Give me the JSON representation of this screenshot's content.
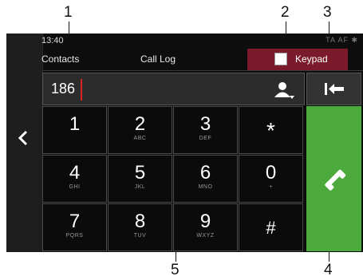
{
  "callouts": [
    "1",
    "2",
    "3",
    "4",
    "5"
  ],
  "status": {
    "time": "13:40",
    "indicators": "TA AF ✱"
  },
  "tabs": {
    "contacts": "Contacts",
    "call_log": "Call Log",
    "keypad": "Keypad"
  },
  "number_field": {
    "value": "186"
  },
  "keys": [
    {
      "digit": "1",
      "letters": ""
    },
    {
      "digit": "2",
      "letters": "ABC"
    },
    {
      "digit": "3",
      "letters": "DEF"
    },
    {
      "digit": "*",
      "letters": ""
    },
    {
      "digit": "4",
      "letters": "GHI"
    },
    {
      "digit": "5",
      "letters": "JKL"
    },
    {
      "digit": "6",
      "letters": "MNO"
    },
    {
      "digit": "0",
      "letters": "+"
    },
    {
      "digit": "7",
      "letters": "PQRS"
    },
    {
      "digit": "8",
      "letters": "TUV"
    },
    {
      "digit": "9",
      "letters": "WXYZ"
    },
    {
      "digit": "#",
      "letters": ""
    }
  ],
  "icons": {
    "back": "chevron-left-icon",
    "contacts": "contact-picker-icon",
    "backspace": "backspace-icon",
    "call": "phone-icon"
  },
  "colors": {
    "call": "#4caa3c",
    "active_tab": "#7a1a2a",
    "cursor": "#dd2222"
  }
}
